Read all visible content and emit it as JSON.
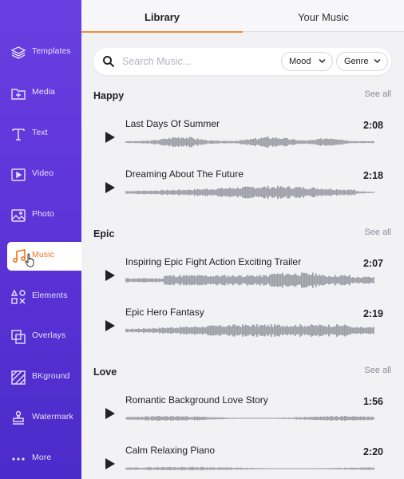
{
  "sidebar": {
    "items": [
      {
        "label": "Templates",
        "icon": "layers-icon"
      },
      {
        "label": "Media",
        "icon": "media-folder-icon"
      },
      {
        "label": "Text",
        "icon": "text-icon"
      },
      {
        "label": "Video",
        "icon": "video-icon"
      },
      {
        "label": "Photo",
        "icon": "photo-icon"
      },
      {
        "label": "Music",
        "icon": "music-note-icon",
        "active": true
      },
      {
        "label": "Elements",
        "icon": "elements-icon"
      },
      {
        "label": "Overlays",
        "icon": "overlays-icon"
      },
      {
        "label": "BKground",
        "icon": "background-icon"
      },
      {
        "label": "Watermark",
        "icon": "watermark-stamp-icon"
      },
      {
        "label": "More",
        "icon": "more-dots-icon"
      }
    ],
    "accent_color": "#f0731e",
    "background_color": "#5a32d6"
  },
  "tabs": [
    {
      "label": "Library",
      "active": true
    },
    {
      "label": "Your Music",
      "active": false
    }
  ],
  "search": {
    "placeholder": "Search Music...",
    "value": "",
    "filters": [
      {
        "label": "Mood"
      },
      {
        "label": "Genre"
      }
    ]
  },
  "sections": [
    {
      "title": "Happy",
      "see_all": "See all",
      "tracks": [
        {
          "title": "Last Days Of Summer",
          "duration": "2:08"
        },
        {
          "title": "Dreaming About The Future",
          "duration": "2:18"
        }
      ]
    },
    {
      "title": "Epic",
      "see_all": "See all",
      "tracks": [
        {
          "title": "Inspiring Epic Fight Action Exciting Trailer",
          "duration": "2:07"
        },
        {
          "title": "Epic Hero Fantasy",
          "duration": "2:19"
        }
      ]
    },
    {
      "title": "Love",
      "see_all": "See all",
      "tracks": [
        {
          "title": "Romantic Background Love Story",
          "duration": "1:56"
        },
        {
          "title": "Calm Relaxing Piano",
          "duration": "2:20"
        }
      ]
    }
  ]
}
